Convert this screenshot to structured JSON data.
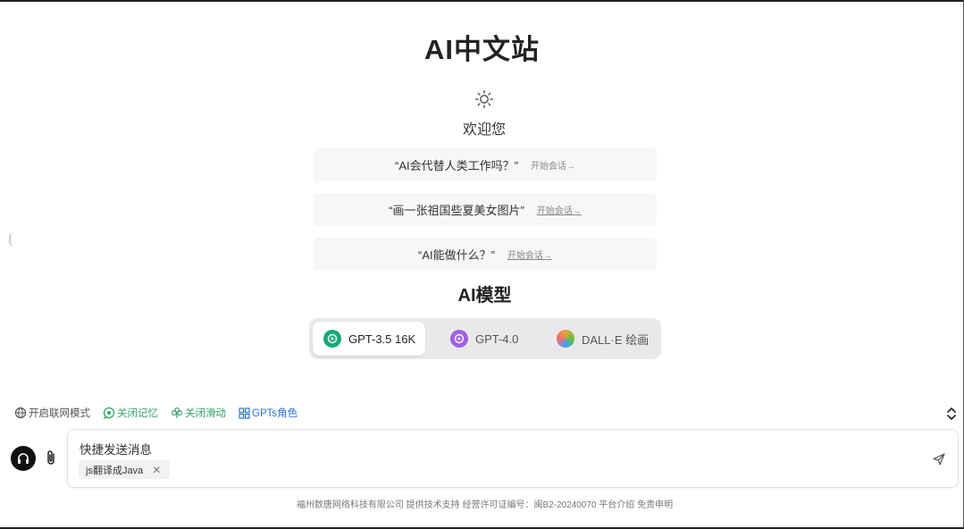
{
  "site_title": "AI中文站",
  "welcome": "欢迎您",
  "suggestions": [
    {
      "question": "“AI会代替人类工作吗？”",
      "action": "开始会话→"
    },
    {
      "question": "“画一张祖国些夏美女图片”",
      "action": "开始会话→"
    },
    {
      "question": "“AI能做什么？”",
      "action": "开始会话→"
    }
  ],
  "models_title": "AI模型",
  "models": [
    {
      "label": "GPT-3.5 16K",
      "color": "#1aa87a"
    },
    {
      "label": "GPT-4.0",
      "color": "#a161e0"
    },
    {
      "label": "DALL·E 绘画",
      "color": "#e6a23c"
    }
  ],
  "toolbar": {
    "web_mode": "开启联网模式",
    "memory": "关闭记忆",
    "scroll": "关闭滑动",
    "gpts": "GPTs角色"
  },
  "input": {
    "text": "快捷发送消息",
    "chip": "js翻译成Java"
  },
  "footer": "福州数唐网络科技有限公司 提供技术支持 经营许可证编号：闽B2-20240070 平台介绍 免责申明",
  "colors": {
    "green": "#38a169",
    "blue": "#2f6fd6",
    "gray_icon": "#555555"
  }
}
